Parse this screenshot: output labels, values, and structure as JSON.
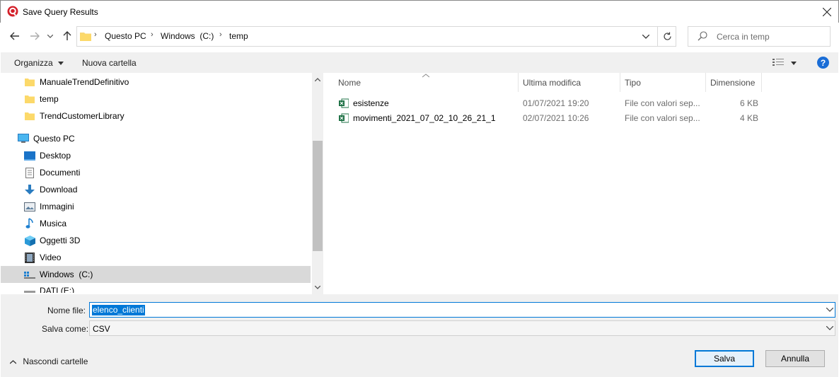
{
  "window": {
    "title": "Save Query Results"
  },
  "address": {
    "crumbs": [
      "Questo PC",
      "Windows  (C:)",
      "temp"
    ]
  },
  "search": {
    "placeholder": "Cerca in temp"
  },
  "toolbar": {
    "organize_label": "Organizza",
    "new_folder_label": "Nuova cartella"
  },
  "tree": {
    "items": [
      {
        "label": "ManualeTrendDefinitivo",
        "icon": "folder-icon"
      },
      {
        "label": "temp",
        "icon": "folder-icon"
      },
      {
        "label": "TrendCustomerLibrary",
        "icon": "folder-icon"
      },
      {
        "label": "Questo PC",
        "icon": "computer-icon"
      },
      {
        "label": "Desktop",
        "icon": "desktop-icon"
      },
      {
        "label": "Documenti",
        "icon": "documents-icon"
      },
      {
        "label": "Download",
        "icon": "download-icon"
      },
      {
        "label": "Immagini",
        "icon": "pictures-icon"
      },
      {
        "label": "Musica",
        "icon": "music-icon"
      },
      {
        "label": "Oggetti 3D",
        "icon": "3d-objects-icon"
      },
      {
        "label": "Video",
        "icon": "video-icon"
      },
      {
        "label": "Windows  (C:)",
        "icon": "drive-icon"
      },
      {
        "label": "DATI (E:)",
        "icon": "drive-icon"
      }
    ]
  },
  "columns": {
    "name": "Nome",
    "modified": "Ultima modifica",
    "type": "Tipo",
    "size": "Dimensione"
  },
  "files": [
    {
      "name": "esistenze",
      "modified": "01/07/2021 19:20",
      "type": "File con valori sep...",
      "size": "6 KB"
    },
    {
      "name": "movimenti_2021_07_02_10_26_21_1",
      "modified": "02/07/2021 10:26",
      "type": "File con valori sep...",
      "size": "4 KB"
    }
  ],
  "form": {
    "filename_label": "Nome file:",
    "filename_value": "elenco_clienti",
    "filetype_label": "Salva come:",
    "filetype_value": "CSV"
  },
  "footer": {
    "hide_folders_label": "Nascondi cartelle",
    "save_label": "Salva",
    "cancel_label": "Annulla"
  },
  "colors": {
    "accent": "#0078d7",
    "selection": "#d9d9d9",
    "excel_green": "#1d7044",
    "app_icon_red": "#d4202a"
  }
}
